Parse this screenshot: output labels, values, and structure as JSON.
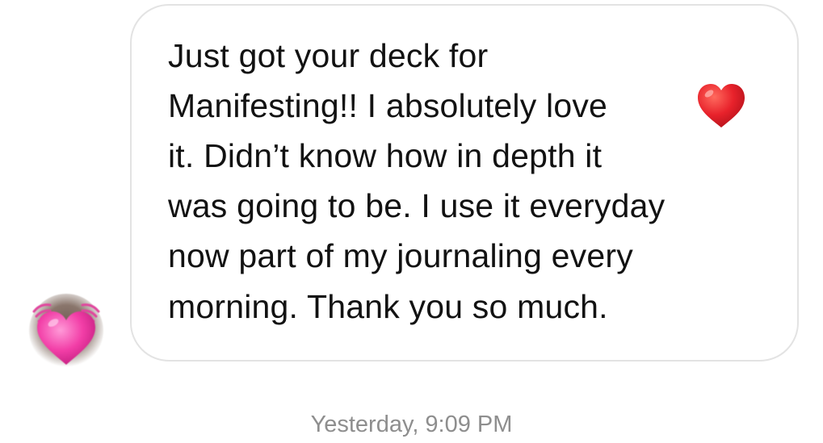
{
  "message": {
    "lines": [
      "Just got your deck for",
      "Manifesting!! I absolutely love",
      "it. Didn’t know how in depth it",
      "was going to be. I use it everyday",
      "now part of my journaling every",
      "morning. Thank you so much."
    ],
    "emoji": "red-heart-emoji"
  },
  "sender": {
    "avatar_badge": "beating-heart-emoji"
  },
  "timestamp": "Yesterday, 9:09 PM",
  "colors": {
    "text": "#121212",
    "bubble_border": "#e3e3e3",
    "timestamp": "#8e8e8e",
    "heart_red": "#e8222b",
    "heart_pink": "#f23ea7"
  }
}
